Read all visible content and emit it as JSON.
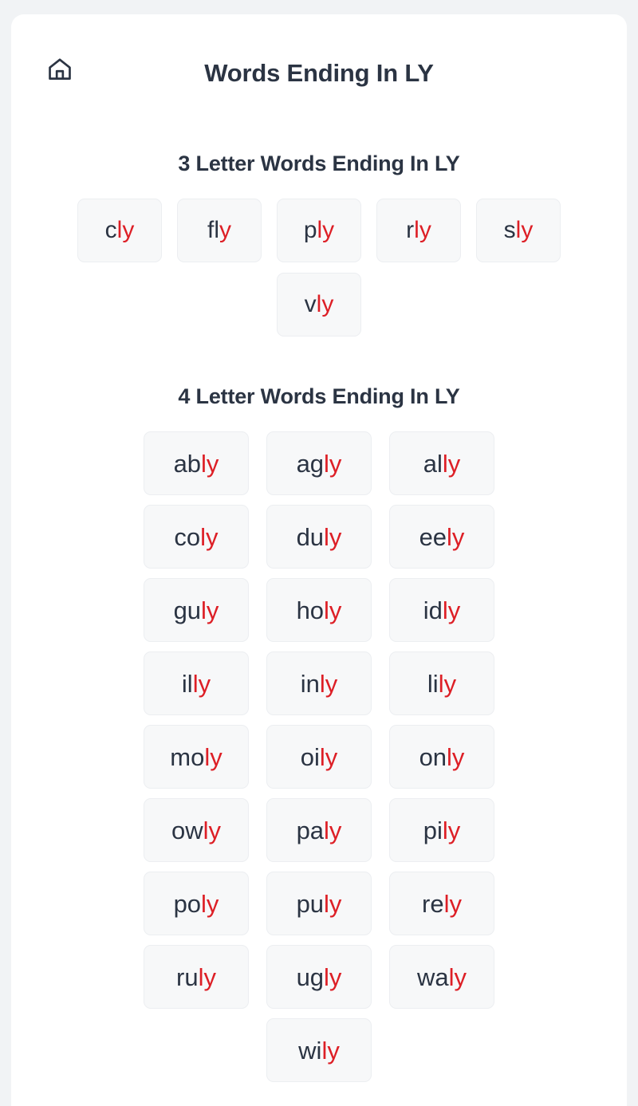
{
  "header": {
    "title": "Words Ending In LY",
    "home_icon": "home-icon"
  },
  "colors": {
    "page_background": "#f1f3f5",
    "card_background": "#ffffff",
    "heading": "#2b3443",
    "chip_background": "#f7f8f9",
    "chip_border": "#eceef1",
    "suffix_highlight": "#dd1f26"
  },
  "sections": [
    {
      "id": "three-letter",
      "title": "3 Letter Words Ending In LY",
      "words": [
        {
          "word": "cly",
          "stem": "c",
          "suffix": "ly"
        },
        {
          "word": "fly",
          "stem": "fl",
          "suffix": "y"
        },
        {
          "word": "ply",
          "stem": "p",
          "suffix": "ly"
        },
        {
          "word": "rly",
          "stem": "r",
          "suffix": "ly"
        },
        {
          "word": "sly",
          "stem": "s",
          "suffix": "ly"
        },
        {
          "word": "vly",
          "stem": "v",
          "suffix": "ly"
        }
      ]
    },
    {
      "id": "four-letter",
      "title": "4 Letter Words Ending In LY",
      "words": [
        {
          "word": "ably",
          "stem": "ab",
          "suffix": "ly"
        },
        {
          "word": "agly",
          "stem": "ag",
          "suffix": "ly"
        },
        {
          "word": "ally",
          "stem": "al",
          "suffix": "ly"
        },
        {
          "word": "coly",
          "stem": "co",
          "suffix": "ly"
        },
        {
          "word": "duly",
          "stem": "du",
          "suffix": "ly"
        },
        {
          "word": "eely",
          "stem": "ee",
          "suffix": "ly"
        },
        {
          "word": "guly",
          "stem": "gu",
          "suffix": "ly"
        },
        {
          "word": "holy",
          "stem": "ho",
          "suffix": "ly"
        },
        {
          "word": "idly",
          "stem": "id",
          "suffix": "ly"
        },
        {
          "word": "illy",
          "stem": "il",
          "suffix": "ly"
        },
        {
          "word": "inly",
          "stem": "in",
          "suffix": "ly"
        },
        {
          "word": "lily",
          "stem": "li",
          "suffix": "ly"
        },
        {
          "word": "moly",
          "stem": "mo",
          "suffix": "ly"
        },
        {
          "word": "oily",
          "stem": "oi",
          "suffix": "ly"
        },
        {
          "word": "only",
          "stem": "on",
          "suffix": "ly"
        },
        {
          "word": "owly",
          "stem": "ow",
          "suffix": "ly"
        },
        {
          "word": "paly",
          "stem": "pa",
          "suffix": "ly"
        },
        {
          "word": "pily",
          "stem": "pi",
          "suffix": "ly"
        },
        {
          "word": "poly",
          "stem": "po",
          "suffix": "ly"
        },
        {
          "word": "puly",
          "stem": "pu",
          "suffix": "ly"
        },
        {
          "word": "rely",
          "stem": "re",
          "suffix": "ly"
        },
        {
          "word": "ruly",
          "stem": "ru",
          "suffix": "ly"
        },
        {
          "word": "ugly",
          "stem": "ug",
          "suffix": "ly"
        },
        {
          "word": "waly",
          "stem": "wa",
          "suffix": "ly"
        },
        {
          "word": "wily",
          "stem": "wi",
          "suffix": "ly"
        }
      ]
    }
  ]
}
